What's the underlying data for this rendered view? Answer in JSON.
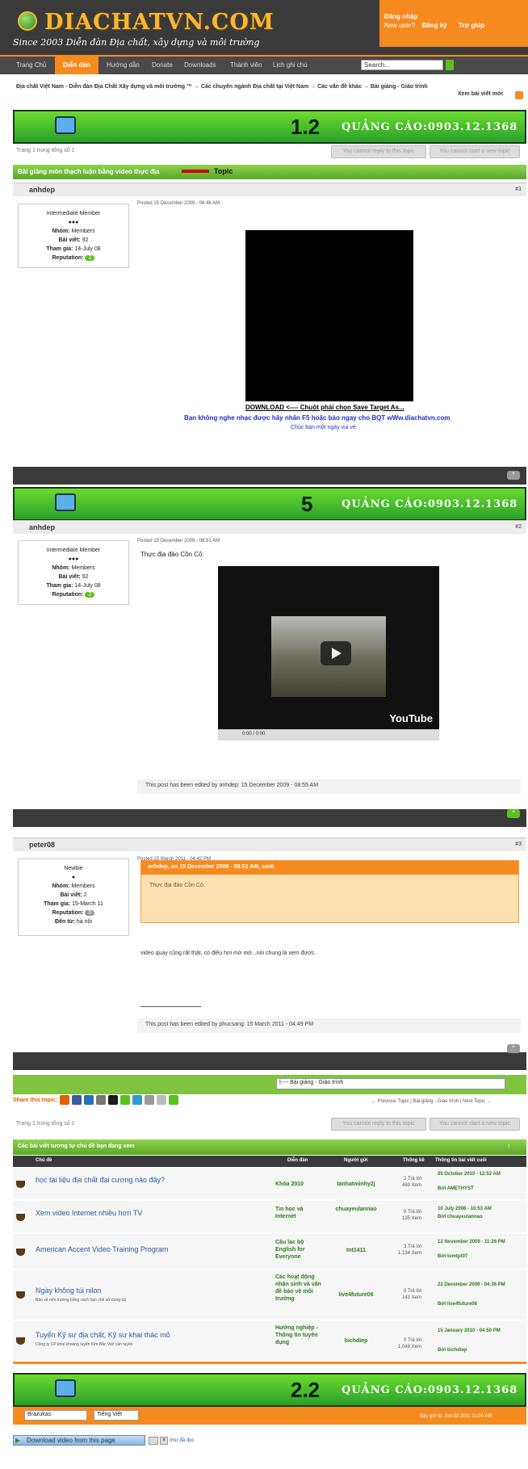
{
  "header": {
    "logo_text": "DIACHATVN.COM",
    "tagline": "Since 2003 Diễn đàn Địa chất, xây dựng và môi trường",
    "login_label": "Đăng nhập",
    "new_user": "New user?",
    "register": "Đăng ký",
    "help": "Trợ giúp"
  },
  "nav": [
    "Trang Chủ",
    "Diễn đàn",
    "Hướng dẫn",
    "Donate",
    "Downloads",
    "Thành viên",
    "Lịch ghi chú"
  ],
  "search_placeholder": "Search...",
  "breadcrumb": "Địa chất Việt Nam - Diễn đàn Địa Chất Xây dựng và môi trường ™  → Các chuyên ngành Địa chất tại Việt Nam  → Các vấn đề khác  → Bài giảng - Giáo trình",
  "latest": "Xem bài viết mới",
  "ads": [
    {
      "num": "1.2",
      "text": "QUẢNG CÁO:0903.12.1368"
    },
    {
      "num": "5",
      "text": "QUẢNG CÁO:0903.12.1368"
    },
    {
      "num": "2.2",
      "text": "QUẢNG CÁO:0903.12.1368"
    }
  ],
  "page_info": "Trang 1 trong tổng số 1",
  "cannot_reply": "You cannot reply to this topic",
  "cannot_start": "You cannot start a new topic",
  "topic_title": "Bài giảng môn thạch luận bằng video thực địa",
  "topic_annotation": "Topic",
  "posts": [
    {
      "user": "anhdep",
      "num": "#1",
      "posted": "Posted 15 December 2009 - 08:46 AM",
      "rank": "Intermediate Member",
      "stars": "●●●",
      "group": "Members",
      "posts": "92",
      "joined": "14-July 08",
      "rep": "2",
      "rep_color": "#5fbf1f"
    },
    {
      "user": "anhdep",
      "num": "#2",
      "posted": "Posted 15 December 2009 - 08:51 AM",
      "rank": "Intermediate Member",
      "stars": "●●●",
      "group": "Members",
      "posts": "92",
      "joined": "14-July 08",
      "rep": "2",
      "rep_color": "#5fbf1f"
    },
    {
      "user": "peter08",
      "num": "#3",
      "posted": "Posted 15 March 2011 - 04:42 PM",
      "rank": "Newbie",
      "stars": "●",
      "group": "Members",
      "posts": "2",
      "joined": "15-March 11",
      "rep": "0",
      "rep_color": "#999999",
      "from": "hà nội"
    }
  ],
  "labels": {
    "group": "Nhóm:",
    "posts": "Bài viết:",
    "joined": "Tham gia:",
    "rep": "Reputation:",
    "from": "Đến từ:"
  },
  "post1": {
    "download": "DOWNLOAD <---- Chuột phải chọn Save Target As...",
    "notice": "Bạn không nghe nhạc được hãy nhấn F5 hoặc báo ngay cho BQT wWw.diachatvn.com",
    "greeting": "Chúc bạn một ngày vui vẻ."
  },
  "post2": {
    "text": "Thực địa đảo Cồn Cỏ:",
    "video_time": "0:00 / 0:00",
    "edited": "This post has been edited by anhdep: 15 December 2009 - 08:55 AM"
  },
  "post3": {
    "quote_head": "anhdep, on 15 December 2009 - 08:51 AM, said:",
    "quote_body": "Thực địa đảo Cồn Cỏ:",
    "text": "video quay cũng rất thật, có điều hơi mờ mờ...nói chung là xem được.",
    "edited": "This post has been edited by phucsang: 15 March 2011 - 04:49 PM"
  },
  "jump_select": "|---- Bài giảng - Giáo trình",
  "share_label": "Share this topic:",
  "prevnext": "← Previous Topic  |  Bài giảng - Giáo trình  |  Next Topic →",
  "similar": {
    "title": "Các bài viết tương tự chủ đề bạn đang xem",
    "headers": [
      "Chủ đề",
      "Diễn đàn",
      "Người gửi",
      "Thống kê",
      "Thông tin bài viết cuối"
    ],
    "rows": [
      {
        "title": "học tài liệu địa chất đại cương nào đây?",
        "sub": "",
        "forum": "Khóa 2010",
        "user": "tanhatminhy2j",
        "stat1": "2 Trả lời",
        "stat2": "469 Xem",
        "last1": "05 October 2010 - 12:52 AM",
        "last2": "Bởi AMETHYST"
      },
      {
        "title": "Xem video Internet nhiều hơn TV",
        "sub": "",
        "forum": "Tin học và Internet",
        "user": "chuayeulannao",
        "stat1": "0 Trả lời",
        "stat2": "135 Xem",
        "last1": "10 July 2008 - 10:53 AM",
        "last2": "Bởi chuayeulannao"
      },
      {
        "title": "American Accent Video Training Program",
        "sub": "",
        "forum": "Câu lạc bộ English for Everyone",
        "user": "tnt1411",
        "stat1": "3 Trả lời",
        "stat2": "1,134 Xem",
        "last1": "12 November 2009 - 11:26 PM",
        "last2": "Bởi tomtpt07"
      },
      {
        "title": "Ngày không túi nilon",
        "sub": "Bảo vệ môi trường bằng cách hạn chế sử dụng túi",
        "forum": "Các hoạt động nhận sinh và vấn đề bảo vệ môi trường",
        "user": "live4future06",
        "stat1": "0 Trả lời",
        "stat2": "143 Xem",
        "last1": "22 December 2009 - 04:36 PM",
        "last2": "Bởi live4future06"
      },
      {
        "title": "Tuyển Kỹ sư địa chất, Kỹ sư khai thác mỏ",
        "sub": "Công ty CP khai khoáng tuyển Kim Bắc Việt cần tuyển",
        "forum": "Hướng nghiệp - Thông tin tuyển dụng",
        "user": "bichdiep",
        "stat1": "0 Trả lời",
        "stat2": "1,048 Xem",
        "last1": "15 January 2010 - 04:50 PM",
        "last2": "Bởi bichdiep"
      }
    ]
  },
  "footer": {
    "skin": "Brazukas",
    "lang": "Tiếng Việt",
    "time": "Bây giờ là: Jun 02 2011 11:04 AM"
  },
  "download_video": "Download video from this page",
  "read_label": "như đã đọc",
  "colors": {
    "orange": "#f58a1f",
    "green": "#5fbf1f",
    "dark": "#3a3a3a"
  }
}
